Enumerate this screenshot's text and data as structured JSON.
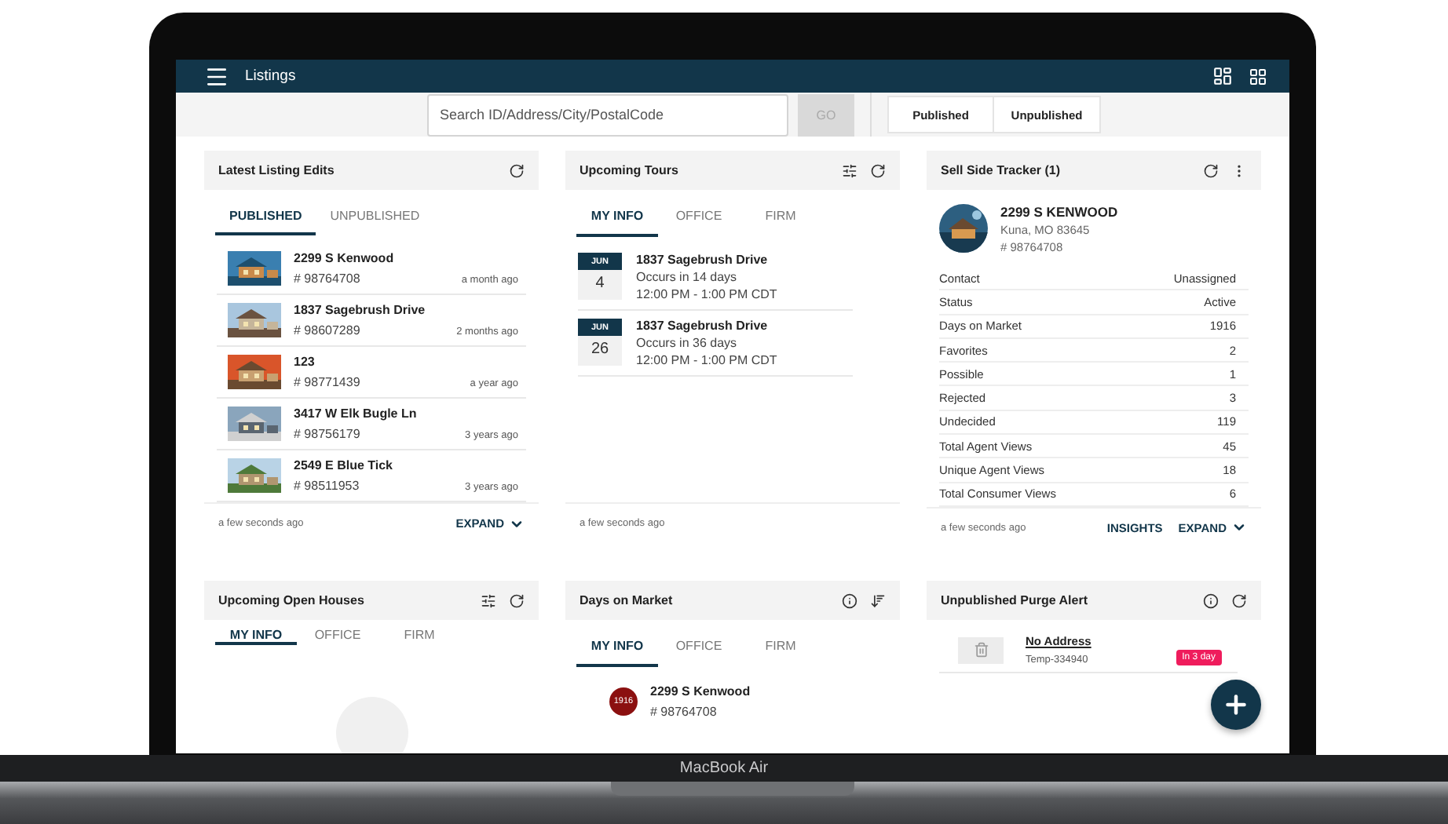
{
  "header": {
    "title": "Listings"
  },
  "search": {
    "placeholder": "Search ID/Address/City/PostalCode",
    "go": "GO",
    "filters": [
      {
        "label": "Published"
      },
      {
        "label": "Unpublished"
      }
    ]
  },
  "cards": [
    {
      "kind": "listings",
      "title": "Latest Listing Edits",
      "tabs": [
        {
          "label": "PUBLISHED",
          "selected": true
        },
        {
          "label": "UNPUBLISHED",
          "selected": false
        }
      ],
      "items": [
        {
          "name": "2299 S Kenwood",
          "number": "# 98764708",
          "time": "a month ago"
        },
        {
          "name": "1837 Sagebrush Drive",
          "number": "# 98607289",
          "time": "2 months ago"
        },
        {
          "name": "123",
          "number": "# 98771439",
          "time": "a year ago"
        },
        {
          "name": "3417 W Elk Bugle Ln",
          "number": "# 98756179",
          "time": "3 years ago"
        },
        {
          "name": "2549 E Blue Tick",
          "number": "# 98511953",
          "time": "3 years ago"
        }
      ],
      "updated": "a few seconds ago",
      "actions": [
        "EXPAND"
      ]
    },
    {
      "kind": "tours",
      "title": "Upcoming Tours",
      "tabs": [
        {
          "label": "MY INFO",
          "selected": true
        },
        {
          "label": "OFFICE",
          "selected": false
        },
        {
          "label": "FIRM",
          "selected": false
        }
      ],
      "items": [
        {
          "month": "JUN",
          "day": "4",
          "name": "1837 Sagebrush Drive",
          "occurs": "Occurs in 14 days",
          "time": "12:00 PM - 1:00 PM CDT"
        },
        {
          "month": "JUN",
          "day": "26",
          "name": "1837 Sagebrush Drive",
          "occurs": "Occurs in 36 days",
          "time": "12:00 PM - 1:00 PM CDT"
        }
      ],
      "updated": "a few seconds ago"
    },
    {
      "kind": "tracker",
      "title": "Sell Side Tracker (1)",
      "listing": {
        "name": "2299 S KENWOOD",
        "city": "Kuna, MO 83645",
        "number": "# 98764708"
      },
      "stats": [
        {
          "label": "Contact",
          "value": "Unassigned"
        },
        {
          "label": "Status",
          "value": "Active"
        },
        {
          "label": "Days on Market",
          "value": "1916"
        },
        {
          "label": "Favorites",
          "value": "2"
        },
        {
          "label": "Possible",
          "value": "1"
        },
        {
          "label": "Rejected",
          "value": "3"
        },
        {
          "label": "Undecided",
          "value": "119"
        },
        {
          "label": "Total Agent Views",
          "value": "45"
        },
        {
          "label": "Unique Agent Views",
          "value": "18"
        },
        {
          "label": "Total Consumer Views",
          "value": "6"
        }
      ],
      "updated": "a few seconds ago",
      "actions": [
        "INSIGHTS",
        "EXPAND"
      ]
    },
    {
      "kind": "open_houses",
      "title": "Upcoming Open Houses",
      "tabs": [
        {
          "label": "MY INFO",
          "selected": true
        },
        {
          "label": "OFFICE",
          "selected": false
        },
        {
          "label": "FIRM",
          "selected": false
        }
      ]
    },
    {
      "kind": "days_on_market",
      "title": "Days on Market",
      "tabs": [
        {
          "label": "MY INFO",
          "selected": true
        },
        {
          "label": "OFFICE",
          "selected": false
        },
        {
          "label": "FIRM",
          "selected": false
        }
      ],
      "items": [
        {
          "days": "1916",
          "name": "2299 S Kenwood",
          "number": "# 98764708"
        }
      ]
    },
    {
      "kind": "purge",
      "title": "Unpublished Purge Alert",
      "items": [
        {
          "name": "No Address",
          "number": "Temp-334940",
          "badge": "In 3 day"
        }
      ]
    }
  ],
  "device": {
    "label": "MacBook Air"
  }
}
